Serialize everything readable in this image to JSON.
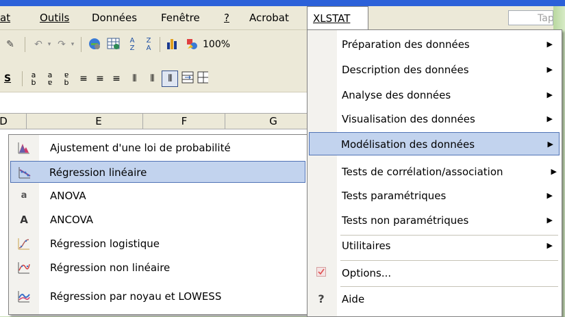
{
  "menubar": {
    "items": [
      {
        "label": "at",
        "underline": ""
      },
      {
        "label": "Outils",
        "underline": "O"
      },
      {
        "label": "Données",
        "underline": "D"
      },
      {
        "label": "Fenêtre",
        "underline": "n"
      },
      {
        "label": "?",
        "underline": "?"
      },
      {
        "label": "Acrobat",
        "underline": "r"
      },
      {
        "label": "XLSTAT",
        "underline": "X"
      }
    ],
    "ask_placeholder": "Tape"
  },
  "toolbar": {
    "zoom": "100%",
    "underline_button": "S"
  },
  "columns": [
    "D",
    "E",
    "F",
    "G"
  ],
  "submenu": {
    "items": [
      {
        "label": "Ajustement d'une loi de probabilité",
        "icon": "distribution-icon"
      },
      {
        "label": "Régression linéaire",
        "icon": "linear-regression-icon",
        "selected": true
      },
      {
        "label": "ANOVA",
        "icon": "anova-icon"
      },
      {
        "label": "ANCOVA",
        "icon": "ancova-icon"
      },
      {
        "label": "Régression logistique",
        "icon": "logistic-regression-icon"
      },
      {
        "label": "Régression non linéaire",
        "icon": "nonlinear-regression-icon"
      },
      {
        "label": "Régression par noyau et LOWESS",
        "icon": "kernel-regression-icon"
      }
    ],
    "icon_glyphs": [
      "",
      "",
      "a",
      "A",
      "",
      "",
      ""
    ]
  },
  "dropdown": {
    "items": [
      {
        "label": "Préparation des données",
        "submenu": true
      },
      {
        "label": "Description des données",
        "submenu": true
      },
      {
        "label": "Analyse des données",
        "submenu": true
      },
      {
        "label": "Visualisation des données",
        "submenu": true
      },
      {
        "label": "Modélisation des données",
        "submenu": true,
        "selected": true
      },
      {
        "label": "Tests de corrélation/association",
        "submenu": true
      },
      {
        "label": "Tests paramétriques",
        "submenu": true
      },
      {
        "label": "Tests non paramétriques",
        "submenu": true
      },
      {
        "label": "Utilitaires",
        "submenu": true
      },
      {
        "label": "Options...",
        "submenu": false,
        "icon": "checkbox-icon"
      },
      {
        "label": "Aide",
        "submenu": false,
        "icon": "help-icon",
        "glyph": "?"
      }
    ]
  },
  "colors": {
    "selection_fill": "#c2d3ee",
    "selection_border": "#4f72b5",
    "title_blue": "#2c61d9",
    "background_green": "#c7dfb4"
  }
}
